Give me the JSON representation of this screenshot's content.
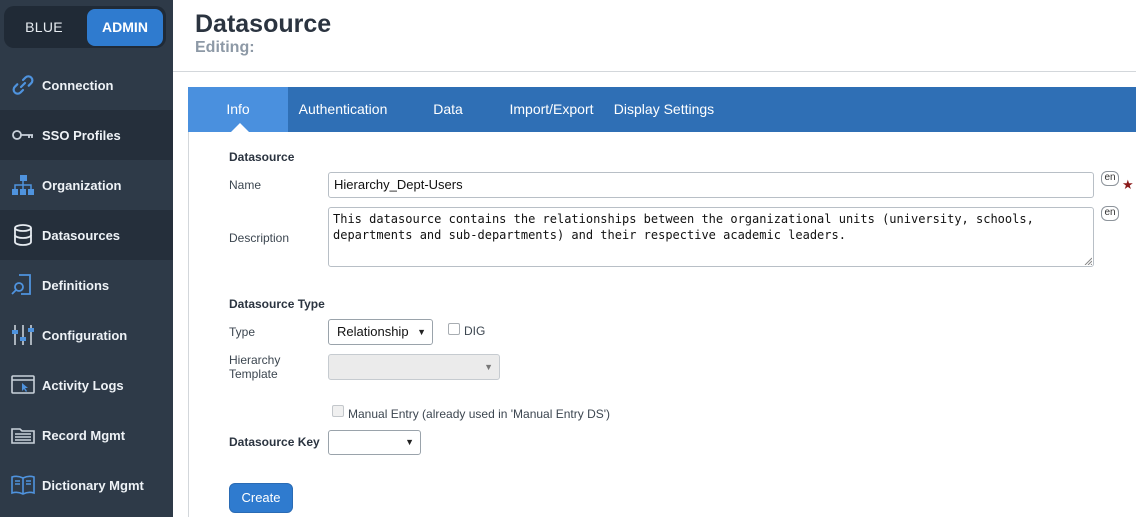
{
  "brand": {
    "left_label": "BLUE",
    "right_label": "ADMIN"
  },
  "sidebar": {
    "items": [
      {
        "label": "Connection",
        "icon": "link-icon"
      },
      {
        "label": "SSO Profiles",
        "icon": "key-icon"
      },
      {
        "label": "Organization",
        "icon": "org-chart-icon"
      },
      {
        "label": "Datasources",
        "icon": "database-icon"
      },
      {
        "label": "Definitions",
        "icon": "search-document-icon"
      },
      {
        "label": "Configuration",
        "icon": "sliders-icon"
      },
      {
        "label": "Activity Logs",
        "icon": "browser-cursor-icon"
      },
      {
        "label": "Record Mgmt",
        "icon": "folder-icon"
      },
      {
        "label": "Dictionary Mgmt",
        "icon": "book-icon"
      }
    ]
  },
  "header": {
    "title": "Datasource",
    "subtitle": "Editing:"
  },
  "tabs": [
    {
      "label": "Info",
      "active": true
    },
    {
      "label": "Authentication",
      "active": false
    },
    {
      "label": "Data",
      "active": false
    },
    {
      "label": "Import/Export",
      "active": false
    },
    {
      "label": "Display Settings",
      "active": false
    }
  ],
  "form": {
    "section_datasource": "Datasource",
    "name_label": "Name",
    "name_value": "Hierarchy_Dept-Users",
    "lang_badge": "en",
    "required_mark": "★",
    "description_label": "Description",
    "description_value": "This datasource contains the relationships between the organizational units (university, schools,\ndepartments and sub-departments) and their respective academic leaders.",
    "section_type": "Datasource Type",
    "type_label": "Type",
    "type_value": "Relationship",
    "dig_label": "DIG",
    "hierarchy_template_label_1": "Hierarchy",
    "hierarchy_template_label_2": "Template",
    "hierarchy_template_value": "",
    "manual_entry_label": "Manual Entry (already used in 'Manual Entry DS')",
    "section_key": "Datasource Key",
    "datasource_key_value": "",
    "create_button": "Create"
  },
  "colors": {
    "sidebar_bg": "#2e3a48",
    "tab_bar": "#2f6fb5",
    "tab_active": "#4a90de",
    "accent": "#2f7bcf"
  }
}
